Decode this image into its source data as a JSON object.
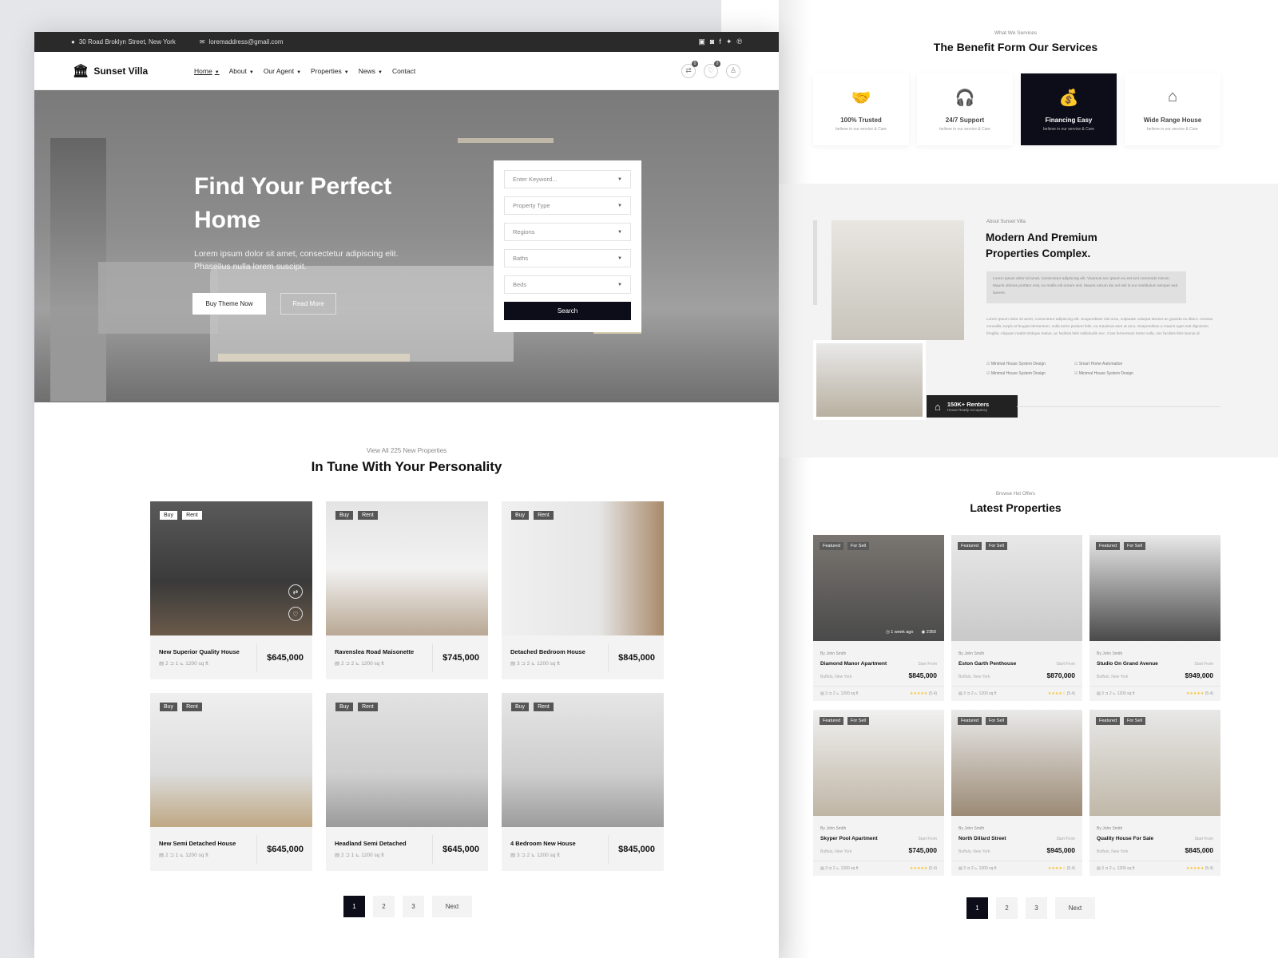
{
  "topbar": {
    "address": "30 Road Broklyn Street, New York",
    "email": "loremaddress@gmail.com",
    "social": [
      "linkedin-icon",
      "instagram-icon",
      "facebook-icon",
      "twitter-icon",
      "pinterest-icon"
    ]
  },
  "nav": {
    "logo": "Sunset Villa",
    "menu": [
      {
        "label": "Home",
        "dropdown": true,
        "active": true
      },
      {
        "label": "About",
        "dropdown": true
      },
      {
        "label": "Our Agent",
        "dropdown": true
      },
      {
        "label": "Properties",
        "dropdown": true
      },
      {
        "label": "News",
        "dropdown": true
      },
      {
        "label": "Contact",
        "dropdown": false
      }
    ],
    "compare_count": "0",
    "wishlist_count": "0"
  },
  "hero": {
    "title": "Find Your Perfect Home",
    "text": "Lorem ipsum dolor sit amet, consectetur adipiscing elit. Phasellus nulla lorem suscipit.",
    "buy_button": "Buy Theme Now",
    "read_button": "Read More",
    "search": {
      "fields": [
        "Enter Keyword...",
        "Property Type",
        "Regions",
        "Baths",
        "Beds"
      ],
      "button": "Search"
    }
  },
  "new_properties": {
    "subtitle": "View All 225 New Properties",
    "title": "In Tune With Your Personality",
    "tags": [
      "Buy",
      "Rent"
    ],
    "items": [
      {
        "name": "New Superior Quality House",
        "beds": "2",
        "baths": "1",
        "area": "1200 sq ft",
        "price": "$645,000"
      },
      {
        "name": "Ravenslea Road Maisonette",
        "beds": "2",
        "baths": "2",
        "area": "1200 sq ft",
        "price": "$745,000"
      },
      {
        "name": "Detached Bedroom House",
        "beds": "3",
        "baths": "2",
        "area": "1200 sq ft",
        "price": "$845,000"
      },
      {
        "name": "New Semi Detached House",
        "beds": "2",
        "baths": "1",
        "area": "1200 sq ft",
        "price": "$645,000"
      },
      {
        "name": "Headland Semi Detached",
        "beds": "2",
        "baths": "1",
        "area": "1200 sq ft",
        "price": "$645,000"
      },
      {
        "name": "4 Bedroom New House",
        "beds": "3",
        "baths": "2",
        "area": "1200 sq ft",
        "price": "$845,000"
      }
    ],
    "pagination": [
      "1",
      "2",
      "3",
      "Next"
    ]
  },
  "services": {
    "subtitle": "What We Services",
    "title": "The Benefit Form Our Services",
    "items": [
      {
        "name": "100% Trusted",
        "desc": "believe in our service & Care",
        "icon": "handshake-icon"
      },
      {
        "name": "24/7 Support",
        "desc": "believe in our service & Care",
        "icon": "headset-icon"
      },
      {
        "name": "Financing Easy",
        "desc": "believe in our service & Care",
        "icon": "money-bag-icon",
        "active": true
      },
      {
        "name": "Wide Range House",
        "desc": "believe in our service & Care",
        "icon": "house-heart-icon"
      }
    ]
  },
  "about": {
    "subtitle": "About Sunset Villa",
    "title": "Modern And Premium Properties Complex.",
    "highlight": "Lorem ipsum dolor sit amet, consectetur adipiscing elit. Vivamus nec ipsum eu est iont commodo rutrum. Mauris ultrices porttitor erat, eu mollis elit ornare sed. Mauris rutrum dui vel nisl is our vestibulum semper sed laoreet.",
    "paragraph": "Lorem ipsum dolor sit amet, consectetur adipiscing elit. Suspendisse nisl urna, vulputate volutpat laoreet ac gravida eu libero. Aenean convallis, turpis at feugiat elementum, nulla tortor pretium felis, eu maximus sem at arcu. Suspendisse a mauris eget erat dignissim fringilla. Aliquam mattis tristique metus, ac facilisis felis sollicitudin nec. Cras fermentum tortor nulla, nec facilisis felis lacinia id.",
    "features": [
      "Minimal House System Design",
      "Smart Home Automation",
      "Minimal House System Design",
      "Minimal House System Design"
    ],
    "badge_count": "150K+ Renters",
    "badge_text": "House Ready Accupancy"
  },
  "latest": {
    "subtitle": "Browse Hot Offers",
    "title": "Latest Properties",
    "tags": [
      "Featured",
      "For Sell"
    ],
    "first_overlay": {
      "time": "1 week ago",
      "views": "2350"
    },
    "items": [
      {
        "author": "By John Smith",
        "name": "Diamond Manor Apartment",
        "location": "Buffalo, New York",
        "start": "Start From",
        "price": "$845,000",
        "beds": "3",
        "baths": "2",
        "area": "1200 sq ft",
        "rating": "(5.4)",
        "stars": 5
      },
      {
        "author": "By John Smith",
        "name": "Eston Garth Penthouse",
        "location": "Buffalo, New York",
        "start": "Start From",
        "price": "$870,000",
        "beds": "3",
        "baths": "2",
        "area": "1200 sq ft",
        "rating": "(5.4)",
        "stars": 4
      },
      {
        "author": "By John Smith",
        "name": "Studio On Grand Avenue",
        "location": "Buffalo, New York",
        "start": "Start From",
        "price": "$949,000",
        "beds": "3",
        "baths": "2",
        "area": "1200 sq ft",
        "rating": "(5.4)",
        "stars": 5
      },
      {
        "author": "By John Smith",
        "name": "Skyper Pool Apartment",
        "location": "Buffalo, New York",
        "start": "Start From",
        "price": "$745,000",
        "beds": "3",
        "baths": "2",
        "area": "1200 sq ft",
        "rating": "(5.4)",
        "stars": 5
      },
      {
        "author": "By John Smith",
        "name": "North Dillard Street",
        "location": "Buffalo, New York",
        "start": "Start From",
        "price": "$945,000",
        "beds": "3",
        "baths": "2",
        "area": "1200 sq ft",
        "rating": "(5.4)",
        "stars": 4
      },
      {
        "author": "By John Smith",
        "name": "Quality House For Sale",
        "location": "Buffalo, New York",
        "start": "Start From",
        "price": "$845,000",
        "beds": "3",
        "baths": "2",
        "area": "1200 sq ft",
        "rating": "(5.4)",
        "stars": 5
      }
    ],
    "pagination": [
      "1",
      "2",
      "3",
      "Next"
    ]
  },
  "colors": {
    "accent": "#0d0d1a",
    "topbar": "#2a2a2a",
    "star": "#f4c430"
  }
}
